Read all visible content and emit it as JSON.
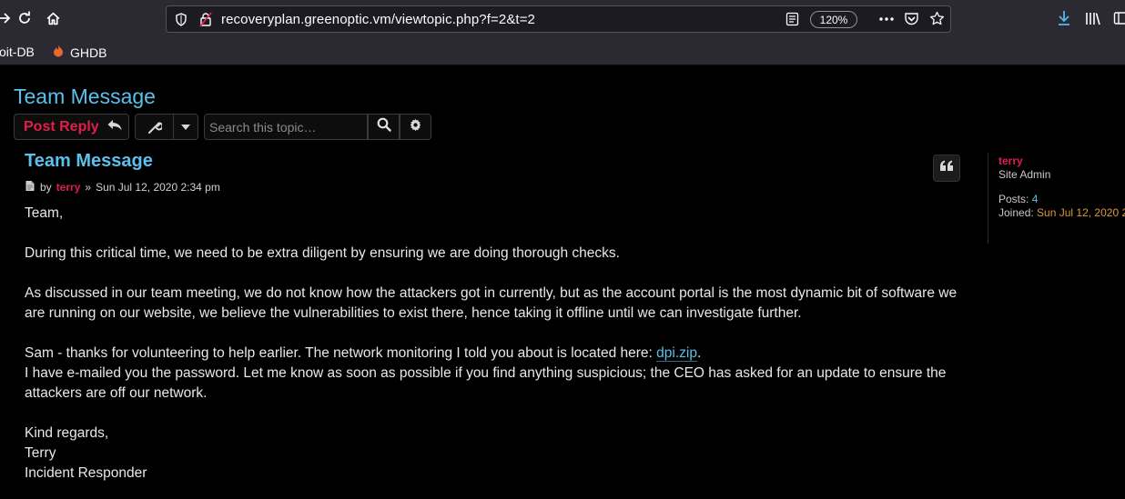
{
  "browser": {
    "url": "recoveryplan.greenoptic.vm/viewtopic.php?f=2&t=2",
    "zoom": "120%"
  },
  "bookmarks": [
    {
      "label": "oit-DB",
      "icon": "exploit-db-icon"
    },
    {
      "label": "GHDB",
      "icon": "ghdb-icon"
    }
  ],
  "topic": {
    "title": "Team Message"
  },
  "actions": {
    "post_reply": "Post Reply",
    "search_placeholder": "Search this topic…"
  },
  "post": {
    "title": "Team Message",
    "by": "by",
    "author": "terry",
    "separator": "»",
    "date": "Sun Jul 12, 2020 2:34 pm",
    "body": {
      "greeting": "Team,",
      "p1": "During this critical time, we need to be extra diligent by ensuring we are doing thorough checks.",
      "p2": "As discussed in our team meeting, we do not know how the attackers got in currently, but as the account portal is the most dynamic bit of software we are running on our website, we believe the vulnerabilities to exist there, hence taking it offline until we can investigate further.",
      "p3_before": "Sam - thanks for volunteering to help earlier. The network monitoring I told you about is located here: ",
      "p3_link": "dpi.zip",
      "p3_after": ".",
      "p4": "I have e-mailed you the password. Let me know as soon as possible if you find anything suspicious; the CEO has asked for an update to ensure the attackers are off our network.",
      "closing": "Kind regards,",
      "name": "Terry",
      "role": "Incident Responder"
    }
  },
  "profile": {
    "username": "terry",
    "rank": "Site Admin",
    "posts_label": "Posts:",
    "posts_value": "4",
    "joined_label": "Joined:",
    "joined_value": "Sun Jul 12, 2020 2"
  },
  "colors": {
    "link": "#5bc0eb",
    "accent_red": "#e01e4b",
    "background": "#000000",
    "chrome": "#2b2a33"
  }
}
